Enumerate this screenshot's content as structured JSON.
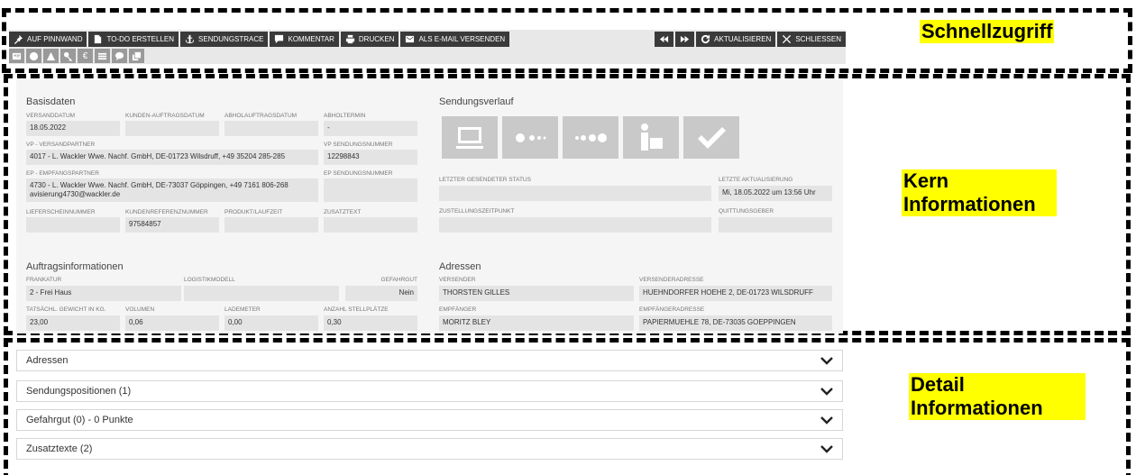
{
  "annotations": {
    "quick": "Schnellzugriff",
    "core": "Kern Informationen",
    "detail": "Detail Informationen"
  },
  "toolbar": {
    "buttons": [
      {
        "label": "AUF PINNWAND",
        "icon": "pin-icon"
      },
      {
        "label": "TO-DO ERSTELLEN",
        "icon": "document-icon"
      },
      {
        "label": "SENDUNGSTRACE",
        "icon": "anchor-icon"
      },
      {
        "label": "KOMMENTAR",
        "icon": "comment-icon"
      },
      {
        "label": "DRUCKEN",
        "icon": "print-icon"
      },
      {
        "label": "ALS E-MAIL VERSENDEN",
        "icon": "mail-icon"
      }
    ],
    "right": {
      "refresh": "AKTUALISIEREN",
      "close": "SCHLIESSEN"
    },
    "small_icons": [
      "address-card-icon",
      "globe-icon",
      "warning-icon",
      "key-icon",
      "euro-icon",
      "list-icon",
      "chat-icon",
      "copy-icon"
    ]
  },
  "basisdaten": {
    "title": "Basisdaten",
    "versanddatum_label": "VERSANDDATUM",
    "versanddatum": "18.05.2022",
    "kundenauftrag_label": "KUNDEN-AUFTRAGSDATUM",
    "abholauftrag_label": "ABHOLAUFTRAGSDATUM",
    "abholtermin_label": "ABHOLTERMIN",
    "abholtermin": "-",
    "vp_label": "VP - VERSANDPARTNER",
    "vp": "4017 - L. Wackler Wwe. Nachf. GmbH, DE-01723 Wilsdruff, +49 35204 285-285",
    "vp_nr_label": "VP SENDUNGSNUMMER",
    "vp_nr": "12298843",
    "ep_label": "EP - EMPFANGSPARTNER",
    "ep": "4730 - L. Wackler Wwe. Nachf. GmbH, DE-73037 Göppingen, +49 7161 806-268 avisierung4730@wackler.de",
    "ep_nr_label": "EP SENDUNGSNUMMER",
    "lieferschein_label": "LIEFERSCHEINNUMMER",
    "kundenref_label": "KUNDENREFERENZNUMMER",
    "kundenref": "97584857",
    "produkt_label": "PRODUKT/LAUFZEIT",
    "zusatztext_label": "ZUSATZTEXT"
  },
  "sendungsverlauf": {
    "title": "Sendungsverlauf",
    "icons": [
      "computer-icon",
      "dots-partial-icon",
      "dots-icon",
      "delivery-person-icon",
      "checkmark-icon"
    ],
    "letzter_status_label": "LETZTER GESENDETER STATUS",
    "letzte_aktualisierung_label": "LETZTE AKTUALISIERUNG",
    "letzte_aktualisierung": "Mi, 18.05.2022 um 13:56 Uhr",
    "zustellungszeit_label": "ZUSTELLUNGSZEITPUNKT",
    "quittungsgeber_label": "QUITTUNGSGEBER"
  },
  "auftrag": {
    "title": "Auftragsinformationen",
    "frankatur_label": "FRANKATUR",
    "frankatur": "2 - Frei Haus",
    "logistik_label": "LOGISTIKMODELL",
    "gefahrgut_label": "GEFAHRGUT",
    "gefahrgut": "Nein",
    "gewicht_label": "TATSÄCHL. GEWICHT IN KG.",
    "gewicht": "23,00",
    "volumen_label": "VOLUMEN",
    "volumen": "0,06",
    "lademeter_label": "LADEMETER",
    "lademeter": "0,00",
    "stellplaetze_label": "ANZAHL STELLPLÄTZE",
    "stellplaetze": "0,30"
  },
  "adressen": {
    "title": "Adressen",
    "versender_label": "VERSENDER",
    "versender": "THORSTEN GILLES",
    "versenderadresse_label": "VERSENDERADRESSE",
    "versenderadresse": "HUEHNDORFER HOEHE 2, DE-01723 WILSDRUFF",
    "empfaenger_label": "EMPFÄNGER",
    "empfaenger": "MORITZ BLEY",
    "empfaengeradresse_label": "EMPFÄNGERADRESSE",
    "empfaengeradresse": "PAPIERMUEHLE 78, DE-73035 GOEPPINGEN"
  },
  "details": [
    {
      "label": "Adressen"
    },
    {
      "label": "Sendungspositionen (1)"
    },
    {
      "label": "Gefahrgut (0) - 0 Punkte"
    },
    {
      "label": "Zusatztexte (2)"
    }
  ]
}
